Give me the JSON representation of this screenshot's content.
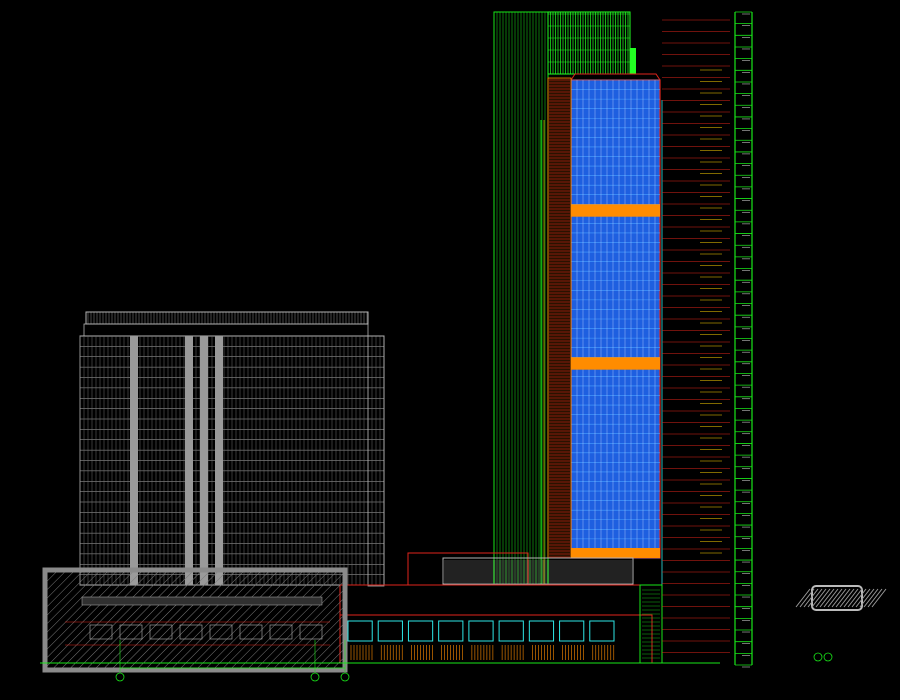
{
  "drawing": {
    "background": "#000000",
    "colors": {
      "red": "#e0241b",
      "green": "#19e619",
      "bright_green": "#22ff22",
      "blue": "#1e5fe0",
      "light_blue": "#4aa0ff",
      "orange": "#ff8c00",
      "gray": "#b4b4b4",
      "dark_gray": "#6e6e6e",
      "cyan": "#2ee6e6",
      "white": "#e8e8e8",
      "yellow": "#ffd400"
    },
    "tower_main": {
      "name": "high-rise-tower",
      "floors": 50,
      "band_floors": [
        13,
        29
      ]
    },
    "tower_left": {
      "name": "grey-hotel-block",
      "floors": 24
    },
    "podium": {
      "name": "podium-retail",
      "bays": 9
    },
    "level_ladder": {
      "name": "elevation-level-column",
      "tick_count": 57
    }
  },
  "legend": {
    "swatch_icon": "hatch-swatch-icon",
    "caption": "",
    "title_label": ""
  },
  "axis_markers": [
    "",
    "",
    ""
  ],
  "dimension_label": ""
}
